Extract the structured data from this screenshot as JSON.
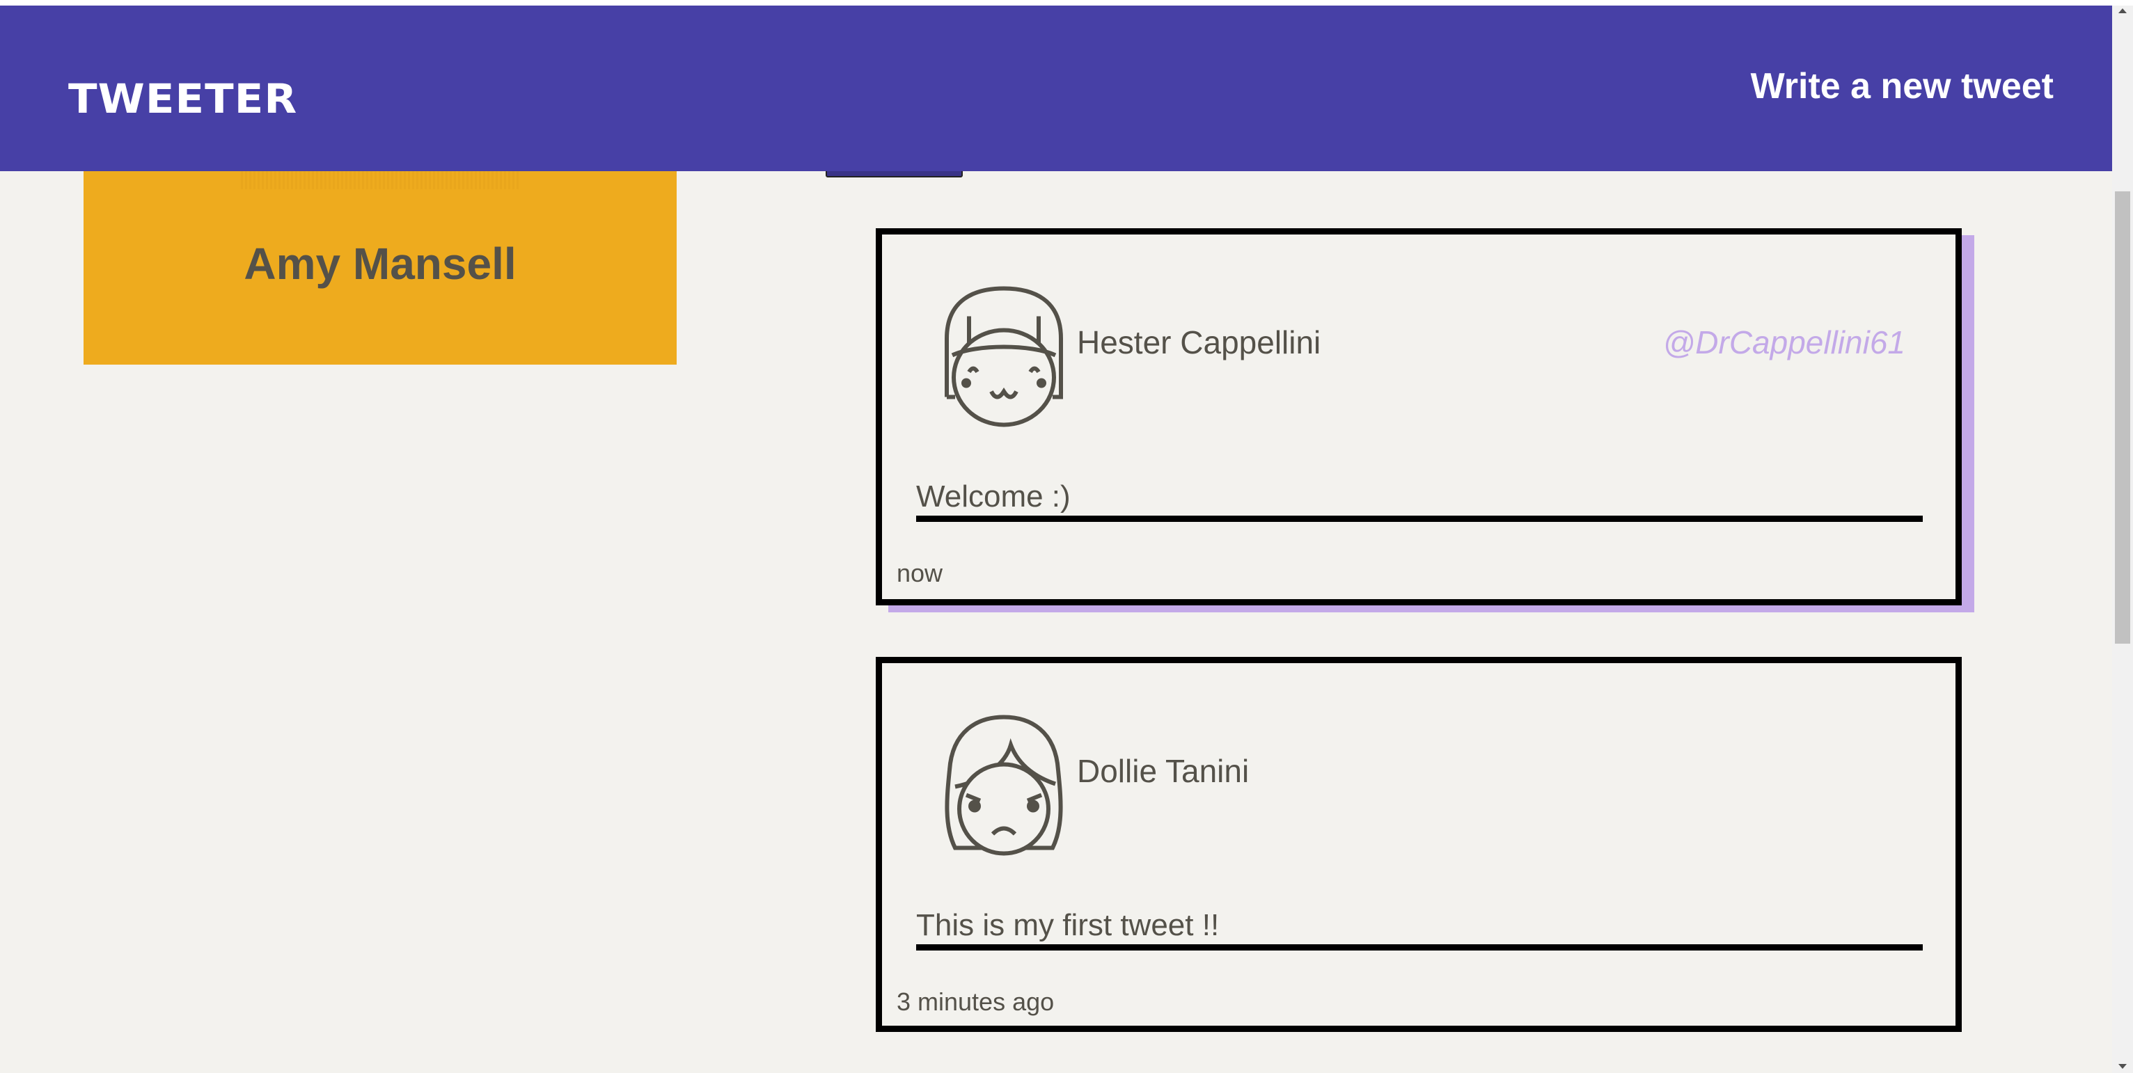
{
  "header": {
    "logo": "TWEETER",
    "compose_label": "Write a new tweet",
    "color": "#4740A6"
  },
  "profile": {
    "name": "Amy Mansell",
    "color": "#EEAB1E"
  },
  "tweets": [
    {
      "name": "Hester Cappellini",
      "handle": "@DrCappellini61",
      "content": "Welcome :)",
      "time": "now",
      "avatar": "smiling-girl-avatar-icon",
      "hovered": true
    },
    {
      "name": "Dollie Tanini",
      "handle": "",
      "content": "This is my first tweet !!",
      "time": "3 minutes ago",
      "avatar": "sad-girl-avatar-icon",
      "hovered": false
    }
  ],
  "colors": {
    "accent_shadow": "#C3A9E8",
    "text": "#545149",
    "background": "#F3F2EE"
  }
}
